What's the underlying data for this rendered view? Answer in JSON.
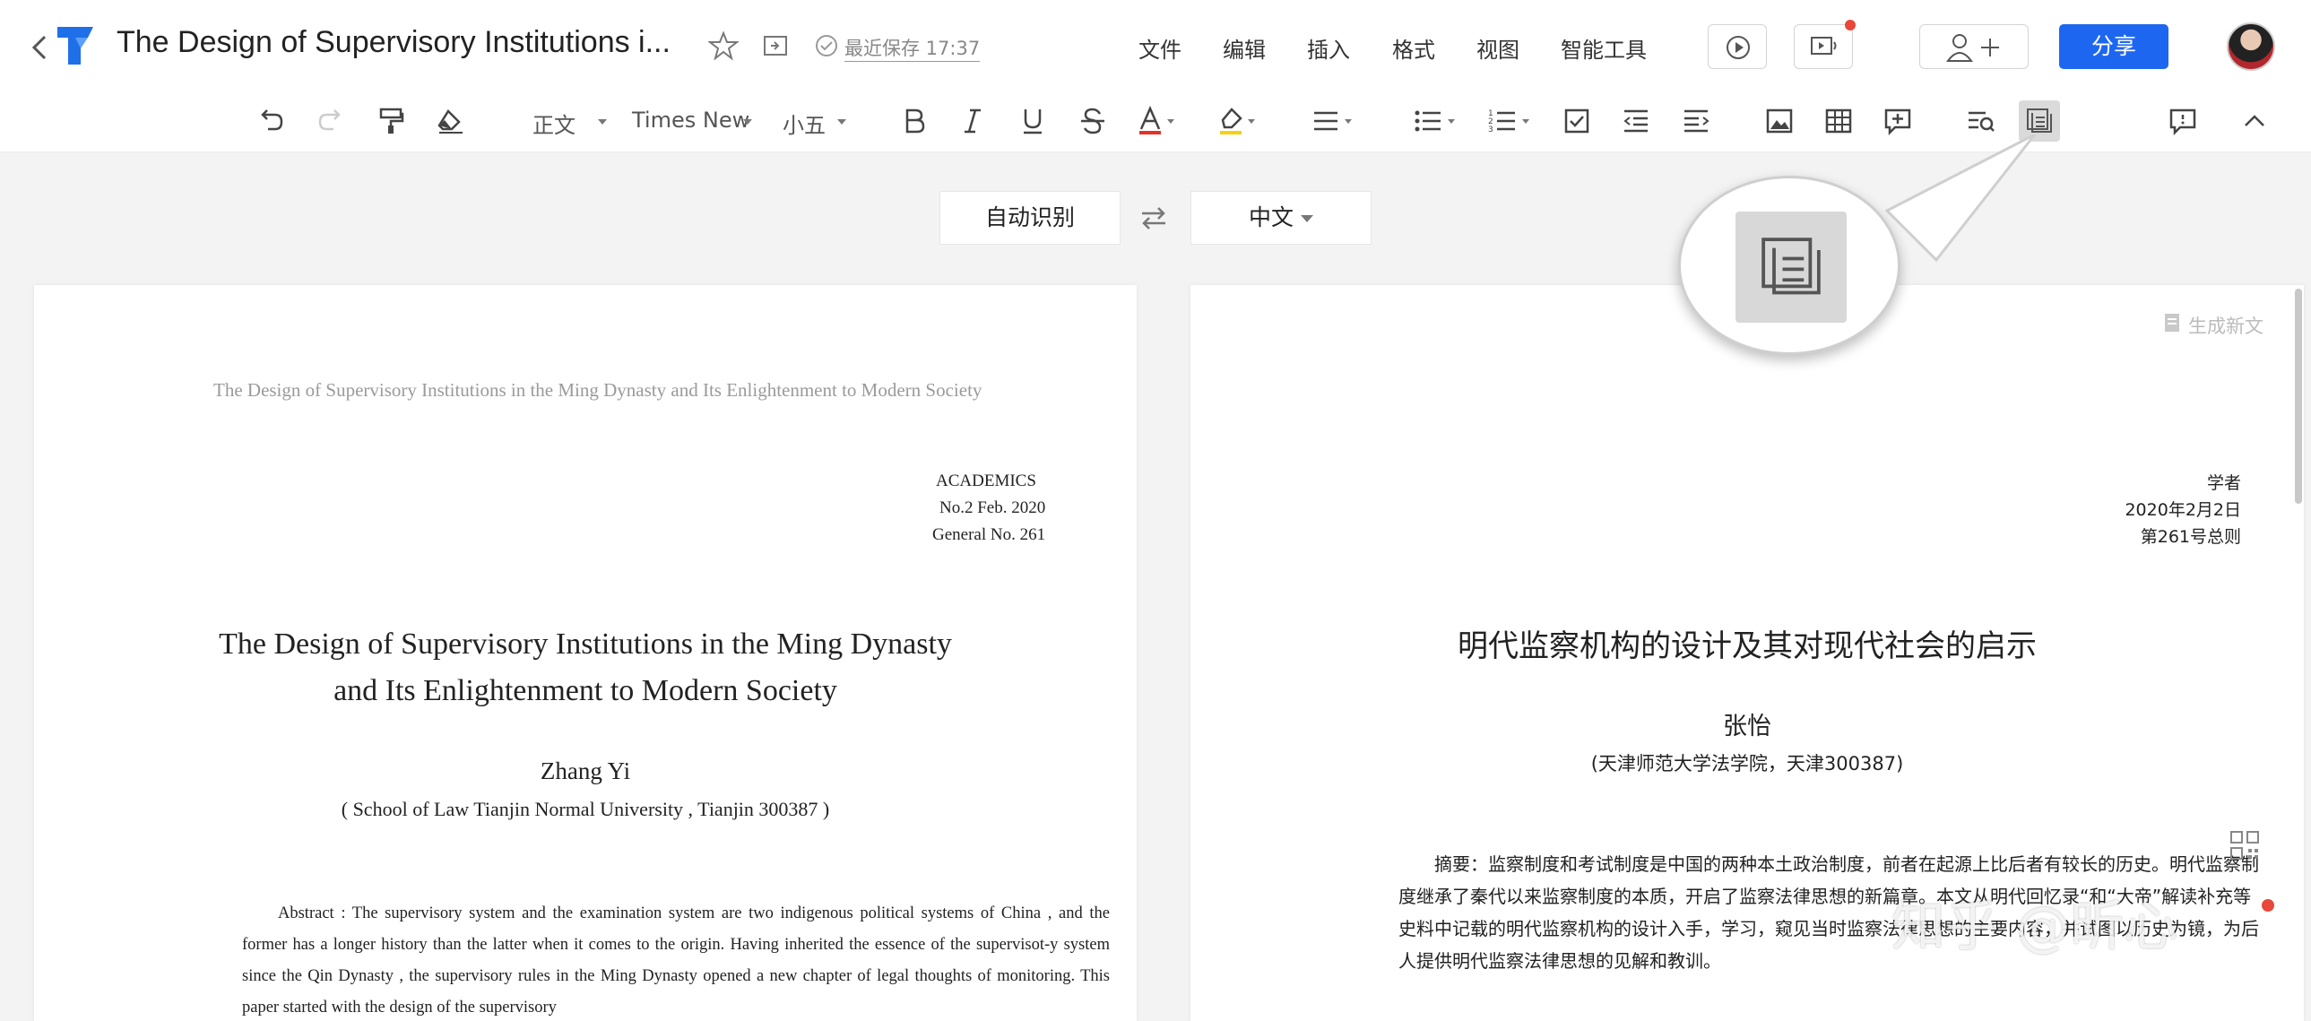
{
  "header": {
    "title": "The Design of Supervisory Institutions i...",
    "save_status": "最近保存 17:37",
    "menus": [
      "文件",
      "编辑",
      "插入",
      "格式",
      "视图",
      "智能工具"
    ],
    "share_label": "分享"
  },
  "toolbar": {
    "style_select": "正文",
    "font_select": "Times New",
    "size_select": "小五"
  },
  "translate": {
    "source_lang": "自动识别",
    "target_lang": "中文"
  },
  "left_doc": {
    "running_head": "The Design of Supervisory Institutions in the Ming Dynasty and Its Enlightenment to Modern Society",
    "journal_name": "ACADEMICS",
    "journal_issue": "No.2 Feb. 2020",
    "journal_general": "General No. 261",
    "title_line1": "The Design of Supervisory Institutions in the Ming Dynasty",
    "title_line2": "and Its Enlightenment to Modern Society",
    "author": "Zhang Yi",
    "affiliation": "( School of Law Tianjin Normal University , Tianjin 300387 )",
    "abstract": "Abstract : The supervisory system and the examination system are two indigenous political systems of China , and the former has a longer history than the latter when it comes to the origin. Having inherited the essence of the supervisot-y system since the Qin Dynasty , the supervisory rules in the Ming Dynasty opened a new chapter of legal thoughts of monitoring. This paper started with the design of the supervisory"
  },
  "right_doc": {
    "generate_new": "生成新文",
    "journal_name": "学者",
    "journal_date": "2020年2月2日",
    "journal_general": "第261号总则",
    "title": "明代监察机构的设计及其对现代社会的启示",
    "author": "张怡",
    "affiliation": "(天津师范大学法学院，天津300387)",
    "abstract": "摘要：监察制度和考试制度是中国的两种本土政治制度，前者在起源上比后者有较长的历史。明代监察制度继承了秦代以来监察制度的本质，开启了监察法律思想的新篇章。本文从明代回忆录“和“大帝”解读补充等史料中记载的明代监察机构的设计入手，学习，窥见当时监察法律思想的主要内容，并试图以历史为镜，为后人提供明代监察法律思想的见解和教训。"
  },
  "watermark": {
    "text": "知乎 @昕心"
  },
  "colors": {
    "accent": "#1d67f0",
    "notify": "#e8473a"
  }
}
